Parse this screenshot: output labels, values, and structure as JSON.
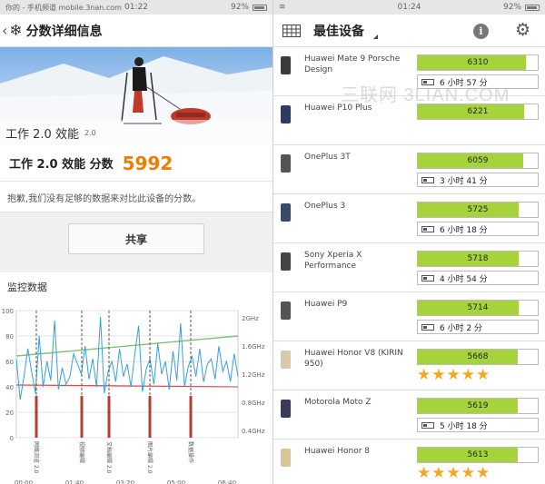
{
  "left": {
    "status": {
      "carrier": "你的 - 手机频道 mobile.3nan.com",
      "time": "01:22",
      "battery": "92%"
    },
    "header": {
      "title": "分数详细信息"
    },
    "hero": {
      "caption": "工作 2.0 效能",
      "version": "2.0"
    },
    "score": {
      "label": "工作 2.0 效能 分数",
      "value": "5992"
    },
    "message": "抱歉,我们没有足够的数据来对比此设备的分数。",
    "share_label": "共享",
    "monitor": {
      "title": "监控数据",
      "y_left_ticks": [
        "100",
        "80",
        "60",
        "40",
        "20",
        "0"
      ],
      "y_right_ticks": [
        "2GHz",
        "1.6GHz",
        "1.2GHz",
        "0.8GHz",
        "0.4GHz"
      ],
      "x_ticks": [
        "00:00",
        "01:40",
        "03:20",
        "05:00",
        "06:40"
      ],
      "markers": [
        "网络浏览 2.0",
        "视频编辑",
        "文档编辑 2.0",
        "图片编辑 2.0",
        "数据操作"
      ]
    }
  },
  "right": {
    "status": {
      "time": "01:24",
      "battery": "92%"
    },
    "header": {
      "title": "最佳设备"
    },
    "watermark": "三联网 3LIAN.COM",
    "devices": [
      {
        "name": "Huawei Mate 9 Porsche Design",
        "score": "6310",
        "fill": 0.9,
        "battery": "6 小时 57 分",
        "stars": 0,
        "color": "#3a3a3a"
      },
      {
        "name": "Huawei P10 Plus",
        "score": "6221",
        "fill": 0.89,
        "battery": "",
        "stars": 0,
        "color": "#2b3b63"
      },
      {
        "name": "OnePlus 3T",
        "score": "6059",
        "fill": 0.88,
        "battery": "3 小时 41 分",
        "stars": 0,
        "color": "#555"
      },
      {
        "name": "OnePlus 3",
        "score": "5725",
        "fill": 0.84,
        "battery": "6 小时 18 分",
        "stars": 0,
        "color": "#3c4a6a"
      },
      {
        "name": "Sony Xperia X Performance",
        "score": "5718",
        "fill": 0.84,
        "battery": "4 小时 54 分",
        "stars": 0,
        "color": "#444"
      },
      {
        "name": "Huawei P9",
        "score": "5714",
        "fill": 0.84,
        "battery": "6 小时 2 分",
        "stars": 0,
        "color": "#555"
      },
      {
        "name": "Huawei Honor V8 (KIRIN 950)",
        "score": "5668",
        "fill": 0.83,
        "battery": "",
        "stars": 5,
        "color": "#d8c9a8"
      },
      {
        "name": "Motorola Moto Z",
        "score": "5619",
        "fill": 0.83,
        "battery": "5 小时 18 分",
        "stars": 0,
        "color": "#3a3a5a"
      },
      {
        "name": "Huawei Honor 8",
        "score": "5613",
        "fill": 0.83,
        "battery": "",
        "stars": 5,
        "color": "#d8c497"
      }
    ]
  }
}
